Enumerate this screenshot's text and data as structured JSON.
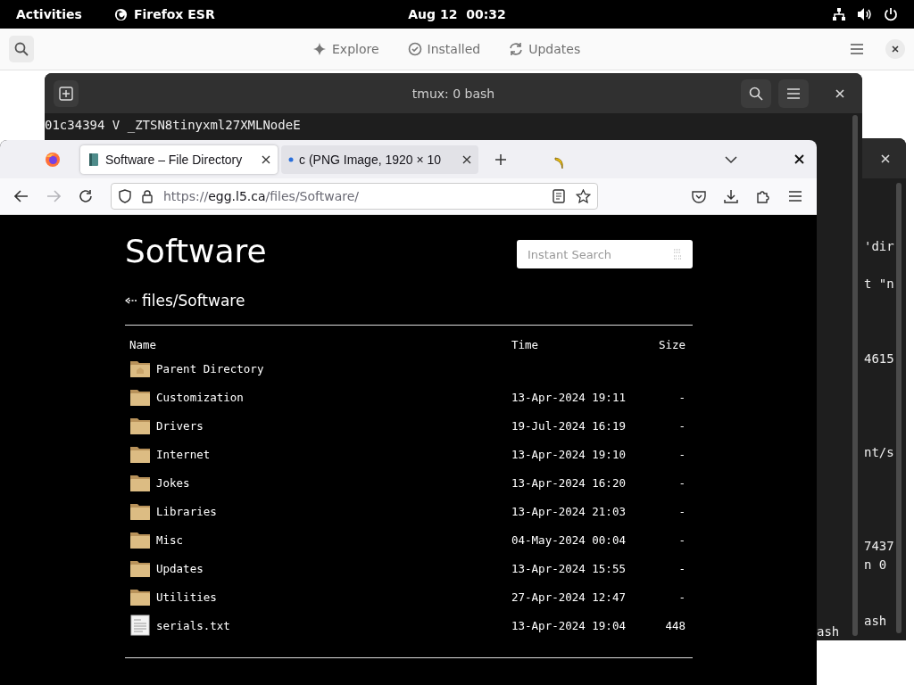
{
  "top_bar": {
    "activities": "Activities",
    "app_name": "Firefox ESR",
    "clock": "Aug 12  00:32"
  },
  "software_window": {
    "tabs": [
      {
        "label": "Explore",
        "selected": false
      },
      {
        "label": "Installed",
        "selected": false
      },
      {
        "label": "Updates",
        "selected": false
      }
    ]
  },
  "terminal_back": {
    "lines": [
      "'dir",
      "t \"n",
      "4615",
      "nt/s",
      "7437",
      "n 0",
      "ash"
    ]
  },
  "terminal_front": {
    "title": "tmux: 0 bash",
    "lines": [
      "01c34394 V _ZTSN8tinyxml27XMLNodeE"
    ],
    "bottom_line": "ash"
  },
  "firefox": {
    "tabs": [
      {
        "title": "Software – File Directory",
        "selected": true
      },
      {
        "title": "c (PNG Image, 1920 × 10",
        "selected": false
      }
    ],
    "forward_disabled": true,
    "url": {
      "scheme": "https://",
      "host": "egg.l5.ca",
      "path": "/files/Software/"
    }
  },
  "page": {
    "title": "Software",
    "search": {
      "placeholder": "Instant Search"
    },
    "breadcrumb": "files/Software",
    "columns": [
      "Name",
      "Time",
      "Size"
    ],
    "rows": [
      {
        "kind": "parent",
        "name": "Parent Directory"
      },
      {
        "kind": "folder",
        "name": "Customization",
        "time": "13-Apr-2024 19:11",
        "size": "-"
      },
      {
        "kind": "folder",
        "name": "Drivers",
        "time": "19-Jul-2024 16:19",
        "size": "-"
      },
      {
        "kind": "folder",
        "name": "Internet",
        "time": "13-Apr-2024 19:10",
        "size": "-"
      },
      {
        "kind": "folder",
        "name": "Jokes",
        "time": "13-Apr-2024 16:20",
        "size": "-"
      },
      {
        "kind": "folder",
        "name": "Libraries",
        "time": "13-Apr-2024 21:03",
        "size": "-"
      },
      {
        "kind": "folder",
        "name": "Misc",
        "time": "04-May-2024 00:04",
        "size": "-"
      },
      {
        "kind": "folder",
        "name": "Updates",
        "time": "13-Apr-2024 15:55",
        "size": "-"
      },
      {
        "kind": "folder",
        "name": "Utilities",
        "time": "27-Apr-2024 12:47",
        "size": "-"
      },
      {
        "kind": "file",
        "name": "serials.txt",
        "time": "13-Apr-2024 19:04",
        "size": "448"
      }
    ]
  }
}
